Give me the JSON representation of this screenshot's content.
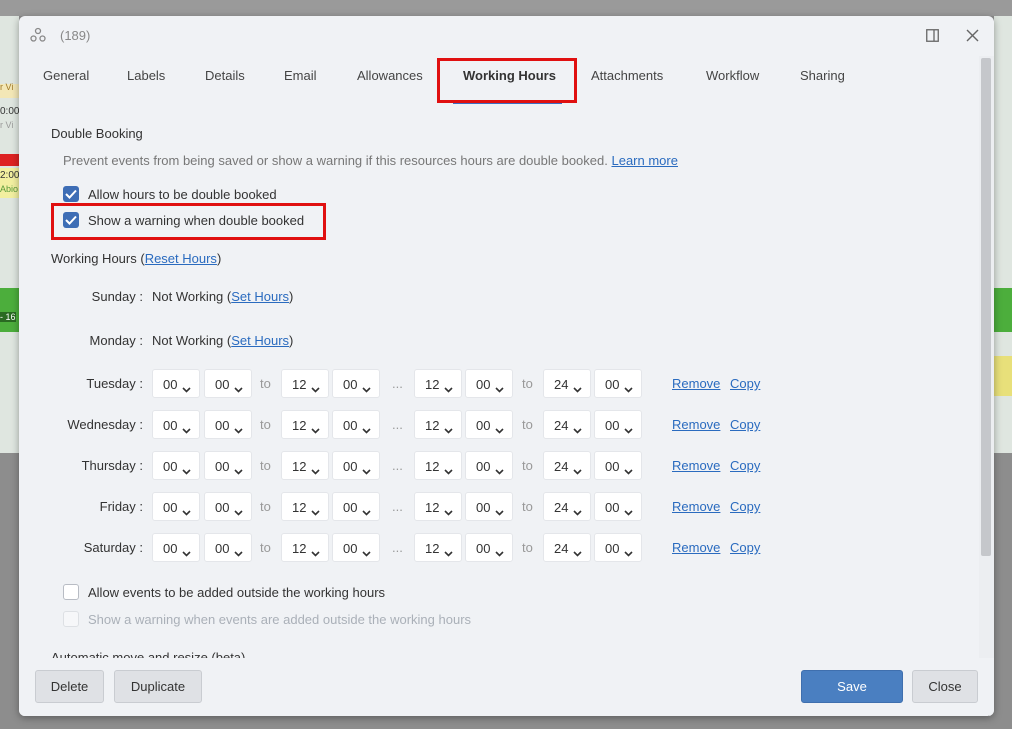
{
  "window": {
    "title": "(189)"
  },
  "tabs": [
    "General",
    "Labels",
    "Details",
    "Email",
    "Allowances",
    "Working Hours",
    "Attachments",
    "Workflow",
    "Sharing"
  ],
  "active_tab": "Working Hours",
  "double_booking": {
    "heading": "Double Booking",
    "description": "Prevent events from being saved or show a warning if this resources hours are double booked.",
    "learn_more": "Learn more",
    "allow_label": "Allow hours to be double booked",
    "warning_label": "Show a warning when double booked"
  },
  "working_hours": {
    "heading": "Working Hours (",
    "reset_link": "Reset Hours",
    "close_paren": ")",
    "not_working_text": "Not Working (",
    "set_hours": "Set Hours",
    "to": "to",
    "ellipsis": "...",
    "remove": "Remove",
    "copy": "Copy",
    "sunday": "Sunday :",
    "monday": "Monday :",
    "rows": [
      {
        "day": "Tuesday :",
        "values": [
          "00",
          "00",
          "12",
          "00",
          "12",
          "00",
          "24",
          "00"
        ]
      },
      {
        "day": "Wednesday :",
        "values": [
          "00",
          "00",
          "12",
          "00",
          "12",
          "00",
          "24",
          "00"
        ]
      },
      {
        "day": "Thursday :",
        "values": [
          "00",
          "00",
          "12",
          "00",
          "12",
          "00",
          "24",
          "00"
        ]
      },
      {
        "day": "Friday :",
        "values": [
          "00",
          "00",
          "12",
          "00",
          "12",
          "00",
          "24",
          "00"
        ]
      },
      {
        "day": "Saturday :",
        "values": [
          "00",
          "00",
          "12",
          "00",
          "12",
          "00",
          "24",
          "00"
        ]
      }
    ],
    "allow_outside_label": "Allow events to be added outside the working hours",
    "warn_outside_label": "Show a warning when events are added outside the working hours",
    "next_heading": "Automatic move and resize (beta)"
  },
  "footer": {
    "delete": "Delete",
    "duplicate": "Duplicate",
    "save": "Save",
    "close": "Close"
  },
  "background_fragments": {
    "a": "r Vi",
    "b": "0:00",
    "c": "r Vi",
    "d": "2:00",
    "e": "Abio",
    "f": "- 16"
  },
  "colors": {
    "accent": "#3d6db5",
    "link": "#2a6bbf",
    "highlight": "#e01010",
    "primary_button": "#4a7fc1"
  }
}
